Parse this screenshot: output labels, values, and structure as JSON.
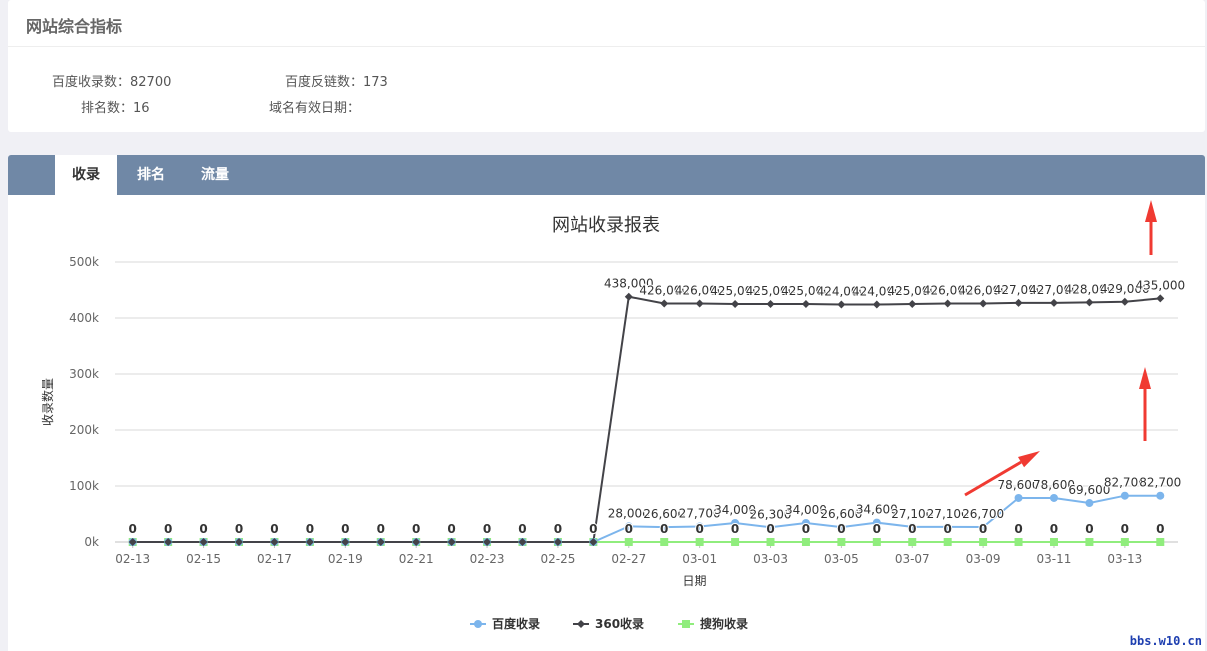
{
  "summary": {
    "title": "网站综合指标",
    "baidu_index": "百度收录数：82700",
    "baidu_backlinks": "百度反链数：173",
    "rank_count": "排名数：16",
    "domain_expiry": "域名有效日期："
  },
  "tabs": [
    {
      "label": "收录",
      "active": true
    },
    {
      "label": "排名",
      "active": false
    },
    {
      "label": "流量",
      "active": false
    }
  ],
  "watermark": "bbs.w10.cn",
  "chart_data": {
    "type": "line",
    "title": "网站收录报表",
    "xlabel": "日期",
    "ylabel": "收录数量",
    "ylim": [
      0,
      500000
    ],
    "yticks": [
      0,
      100000,
      200000,
      300000,
      400000,
      500000
    ],
    "ytick_labels": [
      "0k",
      "100k",
      "200k",
      "300k",
      "400k",
      "500k"
    ],
    "x": [
      "02-13",
      "02-14",
      "02-15",
      "02-16",
      "02-17",
      "02-18",
      "02-19",
      "02-20",
      "02-21",
      "02-22",
      "02-23",
      "02-24",
      "02-25",
      "02-26",
      "02-27",
      "02-28",
      "03-01",
      "03-02",
      "03-03",
      "03-04",
      "03-05",
      "03-06",
      "03-07",
      "03-08",
      "03-09",
      "03-10",
      "03-11",
      "03-12",
      "03-13",
      "03-14"
    ],
    "xtick_labels": [
      "02-13",
      "02-15",
      "02-17",
      "02-19",
      "02-21",
      "02-23",
      "02-25",
      "02-27",
      "03-01",
      "03-03",
      "03-05",
      "03-07",
      "03-09",
      "03-11",
      "03-13"
    ],
    "grid": true,
    "legend_position": "bottom",
    "series": [
      {
        "name": "百度收录",
        "color": "#7cb5ec",
        "marker": "circle",
        "values": [
          0,
          0,
          0,
          0,
          0,
          0,
          0,
          0,
          0,
          0,
          0,
          0,
          0,
          0,
          28000,
          26600,
          27700,
          34000,
          26300,
          34000,
          26600,
          34600,
          27100,
          27100,
          26700,
          78600,
          78600,
          69600,
          82700,
          82700
        ],
        "labels": [
          "",
          "",
          "",
          "",
          "",
          "",
          "",
          "",
          "",
          "",
          "",
          "",
          "",
          "",
          "28,000",
          "26,600",
          "27,700",
          "34,000",
          "26,300",
          "34,000",
          "26,600",
          "34,600",
          "27,100",
          "27,100",
          "26,700",
          "78,600",
          "78,600",
          "69,600",
          "82,700",
          "82,700"
        ]
      },
      {
        "name": "360收录",
        "color": "#434348",
        "marker": "diamond",
        "values": [
          0,
          0,
          0,
          0,
          0,
          0,
          0,
          0,
          0,
          0,
          0,
          0,
          0,
          0,
          438000,
          426000,
          426000,
          425000,
          425000,
          425000,
          424000,
          424000,
          425000,
          426000,
          426000,
          427000,
          427000,
          428000,
          429000,
          435000
        ],
        "labels": [
          "",
          "",
          "",
          "",
          "",
          "",
          "",
          "",
          "",
          "",
          "",
          "",
          "",
          "0",
          "438,000",
          "426,000",
          "426,000",
          "425,000",
          "425,000",
          "425,000",
          "424,000",
          "424,000",
          "425,000",
          "426,000",
          "426,000",
          "427,000",
          "427,000",
          "428,000",
          "429,000",
          "435,000"
        ]
      },
      {
        "name": "搜狗收录",
        "color": "#90ed7d",
        "marker": "square",
        "values": [
          0,
          0,
          0,
          0,
          0,
          0,
          0,
          0,
          0,
          0,
          0,
          0,
          0,
          0,
          0,
          0,
          0,
          0,
          0,
          0,
          0,
          0,
          0,
          0,
          0,
          0,
          0,
          0,
          0,
          0
        ],
        "labels": [
          "0",
          "0",
          "0",
          "0",
          "0",
          "0",
          "0",
          "0",
          "0",
          "0",
          "0",
          "0",
          "0",
          "",
          "0",
          "0",
          "0",
          "0",
          "0",
          "0",
          "0",
          "0",
          "0",
          "0",
          "0",
          "0",
          "0",
          "0",
          "0",
          "0"
        ]
      }
    ]
  }
}
